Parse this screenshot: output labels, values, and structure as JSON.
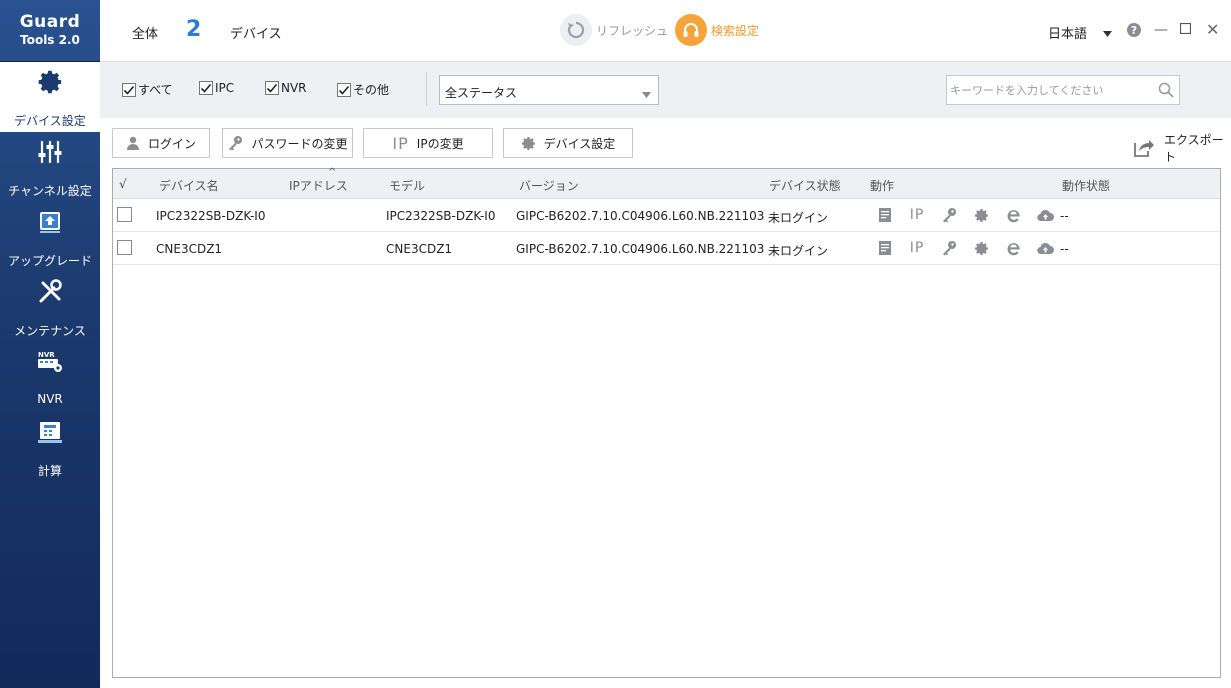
{
  "sidebar": {
    "logo_line1": "Guard",
    "logo_line2": "Tools 2.0",
    "items": [
      {
        "label": "デバイス設定",
        "icon": "gear-icon"
      },
      {
        "label": "チャンネル設定",
        "icon": "sliders-icon"
      },
      {
        "label": "アップグレード",
        "icon": "upgrade-icon"
      },
      {
        "label": "メンテナンス",
        "icon": "tools-icon"
      },
      {
        "label": "NVR",
        "icon": "nvr-icon"
      },
      {
        "label": "計算",
        "icon": "calculator-icon"
      }
    ]
  },
  "topbar": {
    "all_label": "全体",
    "device_count": "2",
    "device_word": "デバイス",
    "refresh_label": "リフレッシュ",
    "search_settings_label": "検索設定",
    "language": "日本語"
  },
  "filters": {
    "checkboxes": [
      {
        "label": "すべて",
        "checked": true
      },
      {
        "label": "IPC",
        "checked": true
      },
      {
        "label": "NVR",
        "checked": true
      },
      {
        "label": "その他",
        "checked": true
      }
    ],
    "status_selected": "全ステータス",
    "keyword_placeholder": "キーワードを入力してください"
  },
  "actions": {
    "login": "ログイン",
    "change_password": "パスワードの変更",
    "ip_prefix": "IP",
    "change_ip": "IPの変更",
    "device_settings": "デバイス設定",
    "export": "エクスポート"
  },
  "table": {
    "check_header": "√",
    "headers": {
      "name": "デバイス名",
      "ip": "IPアドレス",
      "sort_indicator": "^",
      "model": "モデル",
      "version": "バージョン",
      "status": "デバイス状態",
      "ops": "動作",
      "op_status": "動作状態"
    },
    "ip_icon_text": "IP",
    "rows": [
      {
        "name": "IPC2322SB-DZK-I0",
        "ip": "",
        "model": "IPC2322SB-DZK-I0",
        "version": "GIPC-B6202.7.10.C04906.L60.NB.221103",
        "status": "未ログイン",
        "op_status": "--"
      },
      {
        "name": "CNE3CDZ1",
        "ip": "",
        "model": "CNE3CDZ1",
        "version": "GIPC-B6202.7.10.C04906.L60.NB.221103",
        "status": "未ログイン",
        "op_status": "--"
      }
    ]
  },
  "colors": {
    "sidebar_top": "#2a5290",
    "sidebar_bottom": "#13295a",
    "accent_blue": "#2a7bd4",
    "accent_orange": "#f5a33a"
  }
}
